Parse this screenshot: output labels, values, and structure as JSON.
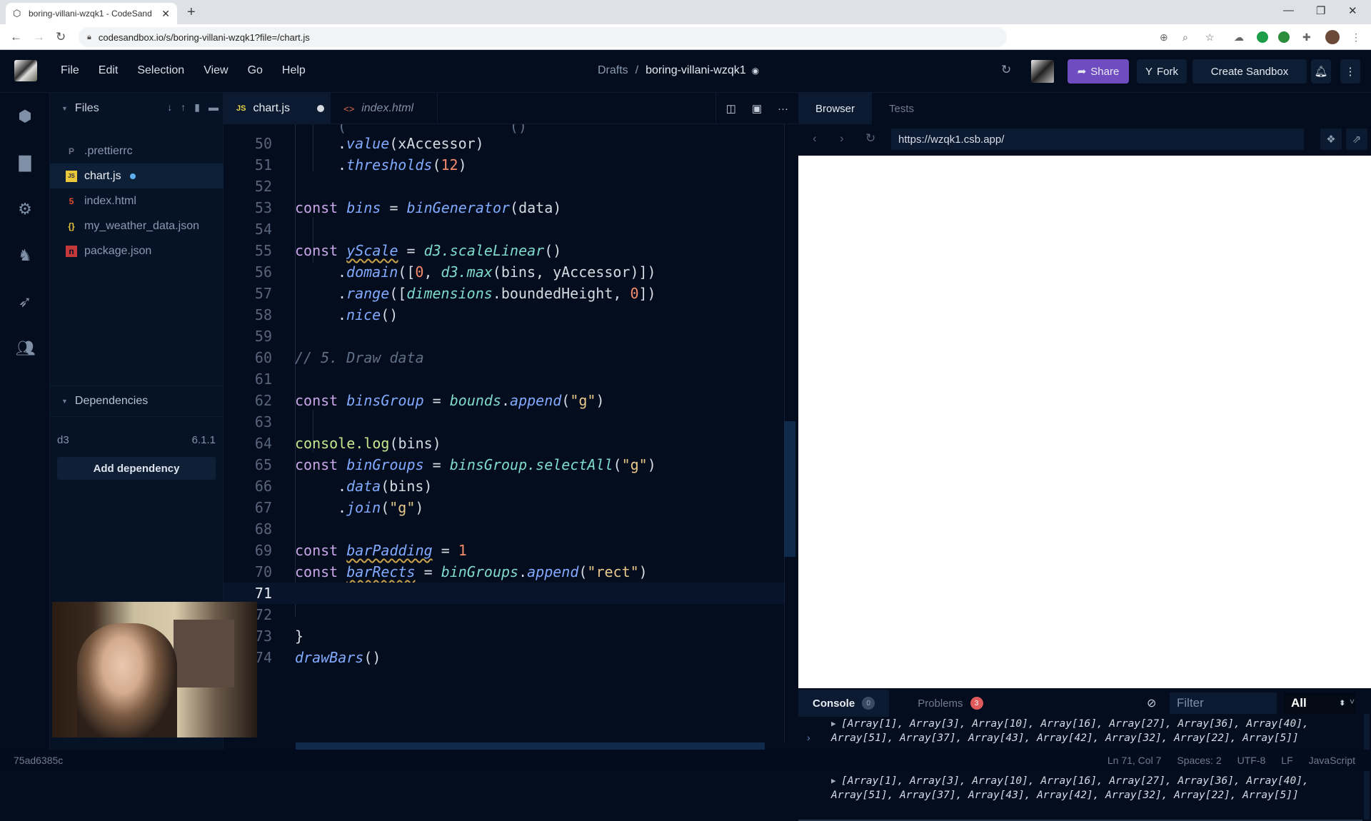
{
  "browser": {
    "tab_title": "boring-villani-wzqk1 - CodeSand",
    "url": "codesandbox.io/s/boring-villani-wzqk1?file=/chart.js"
  },
  "header": {
    "menu": [
      "File",
      "Edit",
      "Selection",
      "View",
      "Go",
      "Help"
    ],
    "breadcrumb_root": "Drafts",
    "breadcrumb_separator": "/",
    "sandbox_name": "boring-villani-wzqk1",
    "share_label": "Share",
    "fork_label": "Fork",
    "create_label": "Create Sandbox"
  },
  "explorer": {
    "title": "Files",
    "files": [
      {
        "name": ".prettierrc",
        "icon": "prettier-icon"
      },
      {
        "name": "chart.js",
        "icon": "js-icon",
        "active": true,
        "modified": true
      },
      {
        "name": "index.html",
        "icon": "html5-icon"
      },
      {
        "name": "my_weather_data.json",
        "icon": "json-icon"
      },
      {
        "name": "package.json",
        "icon": "npm-icon"
      }
    ],
    "dependencies_title": "Dependencies",
    "dependencies": [
      {
        "name": "d3",
        "version": "6.1.1"
      }
    ],
    "add_dependency_label": "Add dependency"
  },
  "editor": {
    "tabs": [
      {
        "label": "chart.js",
        "icon": "JS",
        "modified": true
      },
      {
        "label": "index.html",
        "icon": "<>"
      }
    ],
    "line_numbers": [
      "50",
      "51",
      "52",
      "53",
      "54",
      "55",
      "56",
      "57",
      "58",
      "59",
      "60",
      "61",
      "62",
      "63",
      "64",
      "65",
      "66",
      "67",
      "68",
      "69",
      "70",
      "71",
      "72",
      "73",
      "74"
    ],
    "current_line": "71",
    "lines": {
      "l50": ".value(xAccessor)",
      "l51": ".thresholds(12)",
      "l53": "const bins = binGenerator(data)",
      "l55": "const yScale = d3.scaleLinear()",
      "l56": ".domain([0, d3.max(bins, yAccessor)])",
      "l57": ".range([dimensions.boundedHeight, 0])",
      "l58": ".nice()",
      "l60": "// 5. Draw data",
      "l62": "const binsGroup = bounds.append(\"g\")",
      "l64": "console.log(bins)",
      "l65": "const binGroups = binsGroup.selectAll(\"g\")",
      "l66": ".data(bins)",
      "l67": ".join(\"g\")",
      "l69": "const barPadding = 1",
      "l70": "const barRects = binGroups.append(\"rect\")",
      "l73": "}",
      "l74": "drawBars()"
    }
  },
  "preview": {
    "tabs": [
      "Browser",
      "Tests"
    ],
    "url": "https://wzqk1.csb.app/",
    "console_tab": "Console",
    "console_count": "0",
    "problems_tab": "Problems",
    "problems_count": "3",
    "filter_placeholder": "Filter",
    "level": "All",
    "logs": [
      "[Array[1], Array[3], Array[10], Array[16], Array[27], Array[36], Array[40], Array[51], Array[37], Array[43], Array[42], Array[32], Array[22], Array[5]]",
      "[Array[1], Array[3], Array[10], Array[16], Array[27], Array[36], Array[40], Array[51], Array[37], Array[43], Array[42], Array[32], Array[22], Array[5]]"
    ],
    "prompt": "›"
  },
  "status": {
    "hash": "75ad6385c",
    "position": "Ln 71, Col 7",
    "spaces": "Spaces: 2",
    "encoding": "UTF-8",
    "eol": "LF",
    "language": "JavaScript"
  }
}
